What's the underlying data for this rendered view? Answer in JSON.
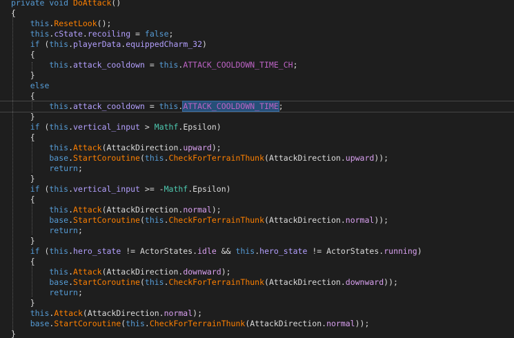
{
  "window": {
    "title": ""
  },
  "colors": {
    "background": "#1e1e1e",
    "text": "#dcdcdc",
    "keyword": "#569cd6",
    "method": "#ff8000",
    "field": "#b4a0ff",
    "constant": "#bd63c5",
    "type": "#4ec9b0",
    "enum_member": "#d9a0f0",
    "selection": "#264f78"
  },
  "code": {
    "lines": [
      [
        {
          "t": "private void ",
          "c": "kw"
        },
        {
          "t": "DoAttack",
          "c": "method"
        },
        {
          "t": "()",
          "c": "punc"
        }
      ],
      [
        {
          "t": "{",
          "c": "punc"
        }
      ],
      [
        {
          "t": "    this",
          "c": "kw"
        },
        {
          "t": ".",
          "c": "punc"
        },
        {
          "t": "ResetLook",
          "c": "method"
        },
        {
          "t": "();",
          "c": "punc"
        }
      ],
      [
        {
          "t": "    this",
          "c": "kw"
        },
        {
          "t": ".",
          "c": "punc"
        },
        {
          "t": "cState",
          "c": "field"
        },
        {
          "t": ".",
          "c": "punc"
        },
        {
          "t": "recoiling",
          "c": "field"
        },
        {
          "t": " = ",
          "c": "punc"
        },
        {
          "t": "false",
          "c": "kw"
        },
        {
          "t": ";",
          "c": "punc"
        }
      ],
      [
        {
          "t": "    if ",
          "c": "kw"
        },
        {
          "t": "(",
          "c": "punc"
        },
        {
          "t": "this",
          "c": "kw"
        },
        {
          "t": ".",
          "c": "punc"
        },
        {
          "t": "playerData",
          "c": "field"
        },
        {
          "t": ".",
          "c": "punc"
        },
        {
          "t": "equippedCharm_32",
          "c": "field"
        },
        {
          "t": ")",
          "c": "punc"
        }
      ],
      [
        {
          "t": "    {",
          "c": "punc"
        }
      ],
      [
        {
          "t": "        this",
          "c": "kw"
        },
        {
          "t": ".",
          "c": "punc"
        },
        {
          "t": "attack_cooldown",
          "c": "field"
        },
        {
          "t": " = ",
          "c": "punc"
        },
        {
          "t": "this",
          "c": "kw"
        },
        {
          "t": ".",
          "c": "punc"
        },
        {
          "t": "ATTACK_COOLDOWN_TIME_CH",
          "c": "const"
        },
        {
          "t": ";",
          "c": "punc"
        }
      ],
      [
        {
          "t": "    }",
          "c": "punc"
        }
      ],
      [
        {
          "t": "    else",
          "c": "kw"
        }
      ],
      [
        {
          "t": "    {",
          "c": "punc"
        }
      ],
      [
        {
          "t": "        this",
          "c": "kw"
        },
        {
          "t": ".",
          "c": "punc"
        },
        {
          "t": "attack_cooldown",
          "c": "field"
        },
        {
          "t": " = ",
          "c": "punc"
        },
        {
          "t": "this",
          "c": "kw"
        },
        {
          "t": ".",
          "c": "punc"
        },
        {
          "t": "ATTACK_COOLDOWN_TIME",
          "c": "const",
          "sel": true
        },
        {
          "t": ";",
          "c": "punc"
        }
      ],
      [
        {
          "t": "    }",
          "c": "punc"
        }
      ],
      [
        {
          "t": "    if ",
          "c": "kw"
        },
        {
          "t": "(",
          "c": "punc"
        },
        {
          "t": "this",
          "c": "kw"
        },
        {
          "t": ".",
          "c": "punc"
        },
        {
          "t": "vertical_input",
          "c": "field"
        },
        {
          "t": " > ",
          "c": "punc"
        },
        {
          "t": "Mathf",
          "c": "type"
        },
        {
          "t": ".",
          "c": "punc"
        },
        {
          "t": "Epsilon",
          "c": "text"
        },
        {
          "t": ")",
          "c": "punc"
        }
      ],
      [
        {
          "t": "    {",
          "c": "punc"
        }
      ],
      [
        {
          "t": "        this",
          "c": "kw"
        },
        {
          "t": ".",
          "c": "punc"
        },
        {
          "t": "Attack",
          "c": "method"
        },
        {
          "t": "(",
          "c": "punc"
        },
        {
          "t": "AttackDirection",
          "c": "text"
        },
        {
          "t": ".",
          "c": "punc"
        },
        {
          "t": "upward",
          "c": "enum"
        },
        {
          "t": ");",
          "c": "punc"
        }
      ],
      [
        {
          "t": "        base",
          "c": "kw"
        },
        {
          "t": ".",
          "c": "punc"
        },
        {
          "t": "StartCoroutine",
          "c": "method"
        },
        {
          "t": "(",
          "c": "punc"
        },
        {
          "t": "this",
          "c": "kw"
        },
        {
          "t": ".",
          "c": "punc"
        },
        {
          "t": "CheckForTerrainThunk",
          "c": "method"
        },
        {
          "t": "(",
          "c": "punc"
        },
        {
          "t": "AttackDirection",
          "c": "text"
        },
        {
          "t": ".",
          "c": "punc"
        },
        {
          "t": "upward",
          "c": "enum"
        },
        {
          "t": "));",
          "c": "punc"
        }
      ],
      [
        {
          "t": "        return",
          "c": "kw"
        },
        {
          "t": ";",
          "c": "punc"
        }
      ],
      [
        {
          "t": "    }",
          "c": "punc"
        }
      ],
      [
        {
          "t": "    if ",
          "c": "kw"
        },
        {
          "t": "(",
          "c": "punc"
        },
        {
          "t": "this",
          "c": "kw"
        },
        {
          "t": ".",
          "c": "punc"
        },
        {
          "t": "vertical_input",
          "c": "field"
        },
        {
          "t": " >= -",
          "c": "punc"
        },
        {
          "t": "Mathf",
          "c": "type"
        },
        {
          "t": ".",
          "c": "punc"
        },
        {
          "t": "Epsilon",
          "c": "text"
        },
        {
          "t": ")",
          "c": "punc"
        }
      ],
      [
        {
          "t": "    {",
          "c": "punc"
        }
      ],
      [
        {
          "t": "        this",
          "c": "kw"
        },
        {
          "t": ".",
          "c": "punc"
        },
        {
          "t": "Attack",
          "c": "method"
        },
        {
          "t": "(",
          "c": "punc"
        },
        {
          "t": "AttackDirection",
          "c": "text"
        },
        {
          "t": ".",
          "c": "punc"
        },
        {
          "t": "normal",
          "c": "enum"
        },
        {
          "t": ");",
          "c": "punc"
        }
      ],
      [
        {
          "t": "        base",
          "c": "kw"
        },
        {
          "t": ".",
          "c": "punc"
        },
        {
          "t": "StartCoroutine",
          "c": "method"
        },
        {
          "t": "(",
          "c": "punc"
        },
        {
          "t": "this",
          "c": "kw"
        },
        {
          "t": ".",
          "c": "punc"
        },
        {
          "t": "CheckForTerrainThunk",
          "c": "method"
        },
        {
          "t": "(",
          "c": "punc"
        },
        {
          "t": "AttackDirection",
          "c": "text"
        },
        {
          "t": ".",
          "c": "punc"
        },
        {
          "t": "normal",
          "c": "enum"
        },
        {
          "t": "));",
          "c": "punc"
        }
      ],
      [
        {
          "t": "        return",
          "c": "kw"
        },
        {
          "t": ";",
          "c": "punc"
        }
      ],
      [
        {
          "t": "    }",
          "c": "punc"
        }
      ],
      [
        {
          "t": "    if ",
          "c": "kw"
        },
        {
          "t": "(",
          "c": "punc"
        },
        {
          "t": "this",
          "c": "kw"
        },
        {
          "t": ".",
          "c": "punc"
        },
        {
          "t": "hero_state",
          "c": "field"
        },
        {
          "t": " != ",
          "c": "punc"
        },
        {
          "t": "ActorStates",
          "c": "text"
        },
        {
          "t": ".",
          "c": "punc"
        },
        {
          "t": "idle",
          "c": "enum"
        },
        {
          "t": " && ",
          "c": "punc"
        },
        {
          "t": "this",
          "c": "kw"
        },
        {
          "t": ".",
          "c": "punc"
        },
        {
          "t": "hero_state",
          "c": "field"
        },
        {
          "t": " != ",
          "c": "punc"
        },
        {
          "t": "ActorStates",
          "c": "text"
        },
        {
          "t": ".",
          "c": "punc"
        },
        {
          "t": "running",
          "c": "enum"
        },
        {
          "t": ")",
          "c": "punc"
        }
      ],
      [
        {
          "t": "    {",
          "c": "punc"
        }
      ],
      [
        {
          "t": "        this",
          "c": "kw"
        },
        {
          "t": ".",
          "c": "punc"
        },
        {
          "t": "Attack",
          "c": "method"
        },
        {
          "t": "(",
          "c": "punc"
        },
        {
          "t": "AttackDirection",
          "c": "text"
        },
        {
          "t": ".",
          "c": "punc"
        },
        {
          "t": "downward",
          "c": "enum"
        },
        {
          "t": ");",
          "c": "punc"
        }
      ],
      [
        {
          "t": "        base",
          "c": "kw"
        },
        {
          "t": ".",
          "c": "punc"
        },
        {
          "t": "StartCoroutine",
          "c": "method"
        },
        {
          "t": "(",
          "c": "punc"
        },
        {
          "t": "this",
          "c": "kw"
        },
        {
          "t": ".",
          "c": "punc"
        },
        {
          "t": "CheckForTerrainThunk",
          "c": "method"
        },
        {
          "t": "(",
          "c": "punc"
        },
        {
          "t": "AttackDirection",
          "c": "text"
        },
        {
          "t": ".",
          "c": "punc"
        },
        {
          "t": "downward",
          "c": "enum"
        },
        {
          "t": "));",
          "c": "punc"
        }
      ],
      [
        {
          "t": "        return",
          "c": "kw"
        },
        {
          "t": ";",
          "c": "punc"
        }
      ],
      [
        {
          "t": "    }",
          "c": "punc"
        }
      ],
      [
        {
          "t": "    this",
          "c": "kw"
        },
        {
          "t": ".",
          "c": "punc"
        },
        {
          "t": "Attack",
          "c": "method"
        },
        {
          "t": "(",
          "c": "punc"
        },
        {
          "t": "AttackDirection",
          "c": "text"
        },
        {
          "t": ".",
          "c": "punc"
        },
        {
          "t": "normal",
          "c": "enum"
        },
        {
          "t": ");",
          "c": "punc"
        }
      ],
      [
        {
          "t": "    base",
          "c": "kw"
        },
        {
          "t": ".",
          "c": "punc"
        },
        {
          "t": "StartCoroutine",
          "c": "method"
        },
        {
          "t": "(",
          "c": "punc"
        },
        {
          "t": "this",
          "c": "kw"
        },
        {
          "t": ".",
          "c": "punc"
        },
        {
          "t": "CheckForTerrainThunk",
          "c": "method"
        },
        {
          "t": "(",
          "c": "punc"
        },
        {
          "t": "AttackDirection",
          "c": "text"
        },
        {
          "t": ".",
          "c": "punc"
        },
        {
          "t": "normal",
          "c": "enum"
        },
        {
          "t": "));",
          "c": "punc"
        }
      ],
      [
        {
          "t": "}",
          "c": "punc"
        }
      ]
    ]
  }
}
